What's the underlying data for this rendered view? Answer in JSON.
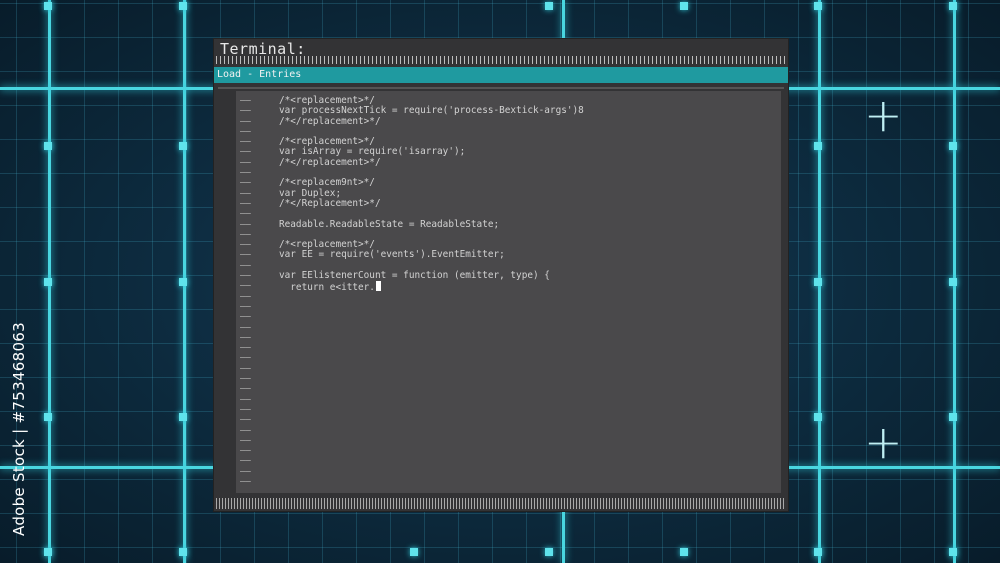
{
  "terminal": {
    "title": "Terminal:",
    "menu_label": "Load - Entries",
    "gutter_marker": "——",
    "gutter_count": 38,
    "code_lines": [
      "/*<replacement>*/",
      "var processNextTick = require('process-Bextick-args')8",
      "/*</replacement>*/",
      "",
      "/*<replacement>*/",
      "var isArray = require('isarray');",
      "/*</replacement>*/",
      "",
      "/*<replacem9nt>*/",
      "var Duplex;",
      "/*</Replacement>*/",
      "",
      "Readable.ReadableState = ReadableState;",
      "",
      "/*<replacement>*/",
      "var EE = require('events').EventEmitter;",
      "",
      "var EElistenerCount = function (emitter, type) {",
      "  return e<itter."
    ]
  },
  "watermark": {
    "text": "Adobe Stock | #753468063"
  },
  "colors": {
    "grid_line": "#49d6e0",
    "menu_bar": "#1f9aa0",
    "editor_bg": "#4a494b",
    "window_bg": "#333335"
  }
}
